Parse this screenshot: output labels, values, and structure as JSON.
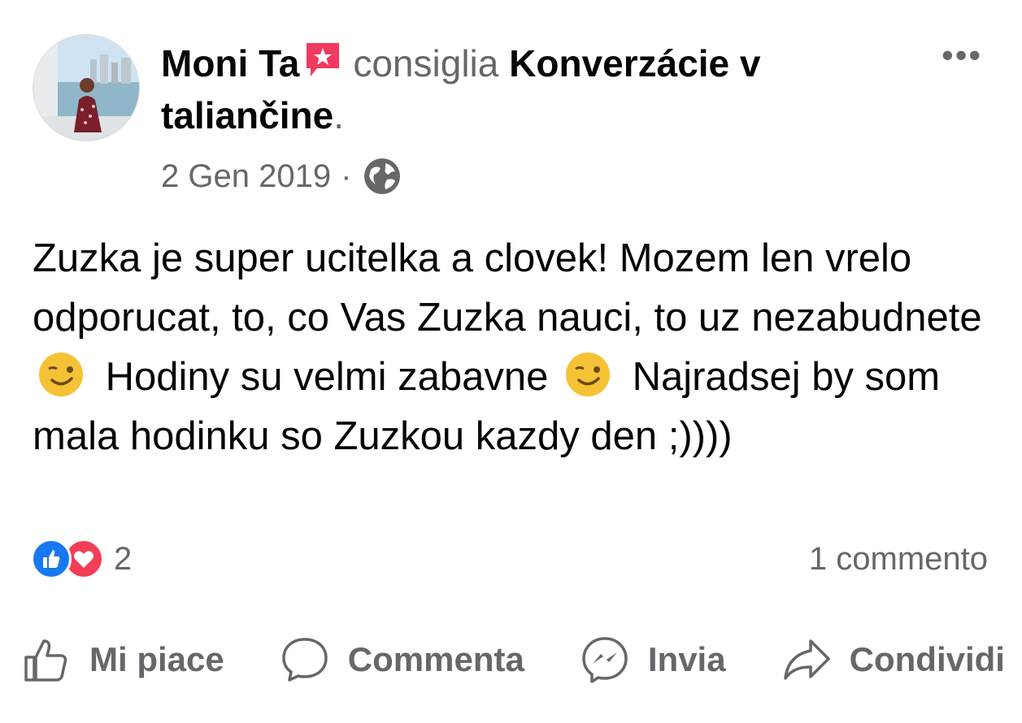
{
  "post": {
    "author_name": "Moni Ta",
    "verb": "consiglia",
    "page_name": "Konverzácie v taliančine",
    "period": ".",
    "date": "2 Gen 2019",
    "separator": "·",
    "more_label": "•••",
    "text_parts": [
      "Zuzka je super ucitelka a clovek! Mozem len vrelo odporucat, to, co Vas Zuzka nauci, to uz nezabudnete",
      "Hodiny su velmi zabavne",
      "Najradsej by som mala hodinku so Zuzkou kazdy den ;))))"
    ],
    "reaction_count": "2",
    "comments_count": "1 commento"
  },
  "actions": {
    "like": "Mi piace",
    "comment": "Commenta",
    "send": "Invia",
    "share": "Condividi"
  },
  "icons": {
    "recommendation_badge": "star-speech-bubble-icon",
    "privacy": "globe-icon",
    "emoji": "winking-face-icon",
    "reaction_like": "like-reaction-icon",
    "reaction_love": "love-reaction-icon"
  },
  "colors": {
    "secondary_text": "#65676b",
    "like_blue": "#1877f2",
    "love_red": "#f33e58",
    "badge_red": "#f03a5f"
  }
}
